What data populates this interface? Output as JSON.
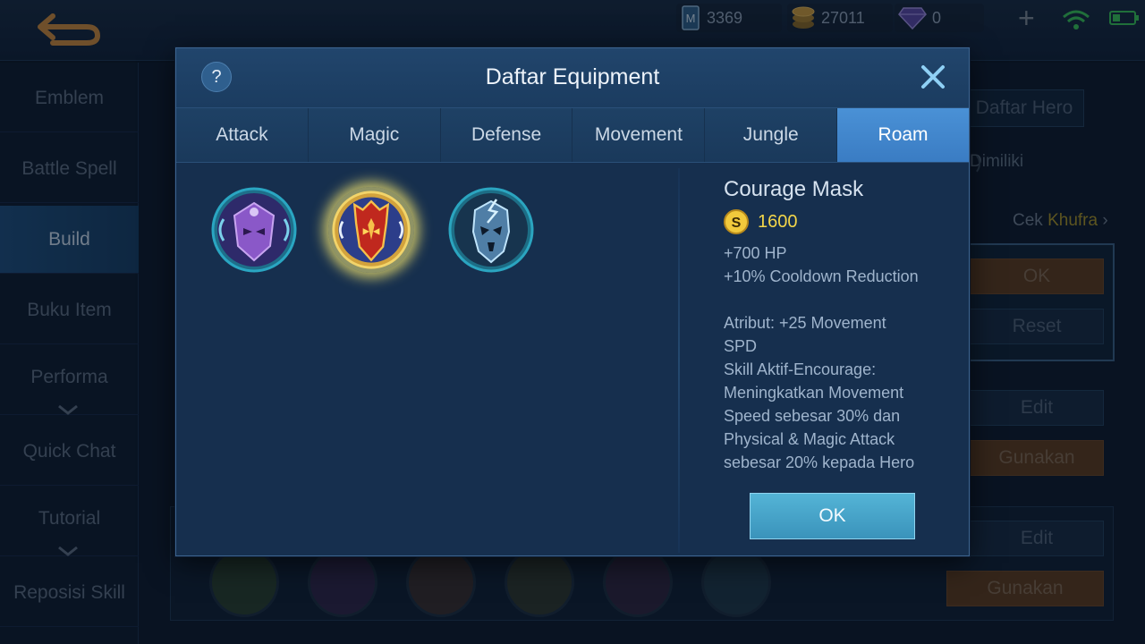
{
  "topbar": {
    "tickets": "3369",
    "coins": "27011",
    "diamonds": "0",
    "icons": [
      "back-arrow-icon",
      "ticket-icon",
      "coin-icon",
      "diamond-icon",
      "plus-icon",
      "wifi-icon",
      "battery-icon"
    ]
  },
  "sidebar": {
    "items": [
      {
        "label": "Emblem"
      },
      {
        "label": "Battle Spell"
      },
      {
        "label": "Build",
        "active": true
      },
      {
        "label": "Buku Item"
      },
      {
        "label": "Performa"
      },
      {
        "label": "Quick Chat"
      },
      {
        "label": "Tutorial"
      },
      {
        "label": "Reposisi Skill"
      }
    ]
  },
  "background": {
    "daftar_hero": "Daftar Hero",
    "dimiliki": "Dimiliki",
    "cek_prefix": "Cek",
    "cek_hero": "Khufra",
    "ok": "OK",
    "reset": "Reset",
    "edit": "Edit",
    "gunakan": "Gunakan"
  },
  "modal": {
    "help": "?",
    "title": "Daftar Equipment",
    "tabs": [
      {
        "label": "Attack"
      },
      {
        "label": "Magic"
      },
      {
        "label": "Defense"
      },
      {
        "label": "Movement"
      },
      {
        "label": "Jungle"
      },
      {
        "label": "Roam",
        "active": true
      }
    ],
    "items": [
      {
        "icon": "purple-mask-icon",
        "selected": false
      },
      {
        "icon": "courage-mask-icon",
        "selected": true
      },
      {
        "icon": "blue-mask-icon",
        "selected": false
      }
    ],
    "detail": {
      "name": "Courage Mask",
      "currency_symbol": "S",
      "price": "1600",
      "stats": [
        "+700 HP",
        "+10% Cooldown Reduction"
      ],
      "lines": [
        "Atribut: +25 Movement",
        "SPD",
        "Skill Aktif-Encourage:",
        "Meningkatkan Movement",
        "Speed sebesar 30% dan",
        "Physical & Magic Attack",
        "sebesar 20% kepada Hero"
      ]
    },
    "ok_label": "OK"
  },
  "colors": {
    "tab_active": "#3a7cc3",
    "price": "#f3d64a",
    "ok_button": "#3a93bb"
  }
}
